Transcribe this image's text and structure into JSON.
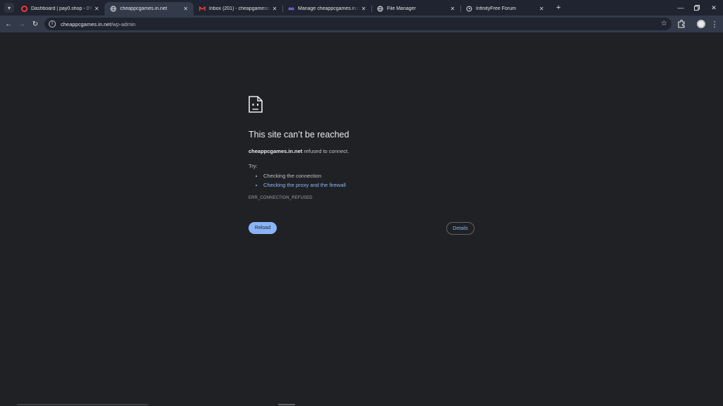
{
  "browser": {
    "tabs": [
      {
        "title": "Dashboard | pay0.shop - 0% Fi",
        "icon": "opera-icon",
        "active": false
      },
      {
        "title": "cheappcgames.in.net",
        "icon": "globe-icon",
        "active": true
      },
      {
        "title": "Inbox (201) - cheapgamescom",
        "icon": "gmail-icon",
        "active": false
      },
      {
        "title": "Manage cheappcgames.in.net",
        "icon": "infinity-icon",
        "active": false
      },
      {
        "title": "File Manager",
        "icon": "globe-icon",
        "active": false
      },
      {
        "title": "InfinityFree Forum",
        "icon": "infinityfree-icon",
        "active": false
      }
    ],
    "address": {
      "host": "cheappcgames.in.net",
      "path": "/wp-admin"
    }
  },
  "error_page": {
    "title": "This site can’t be reached",
    "host": "cheappcgames.in.net",
    "message": " refused to connect.",
    "try_label": "Try:",
    "suggestions": [
      "Checking the connection",
      "Checking the proxy and the firewall"
    ],
    "error_code": "ERR_CONNECTION_REFUSED",
    "reload_label": "Reload",
    "details_label": "Details"
  },
  "colors": {
    "background": "#202124",
    "tabstrip": "#1f2430",
    "toolbar": "#333b4a",
    "link": "#8ab4f8"
  }
}
